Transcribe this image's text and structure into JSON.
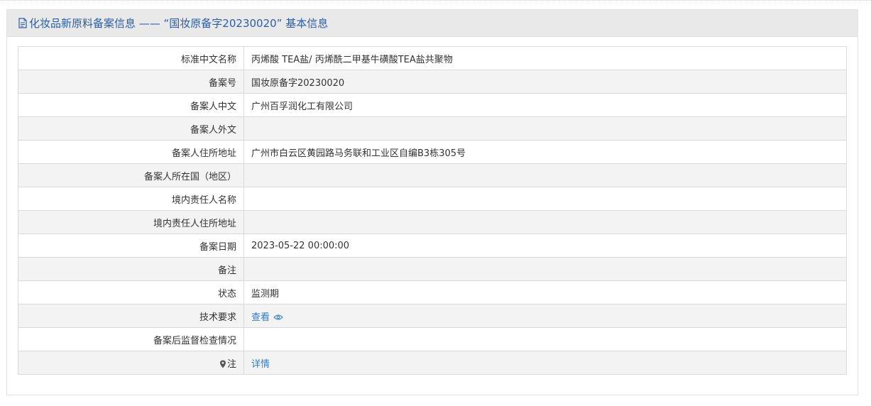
{
  "header": {
    "title": "化妆品新原料备案信息 —— “国妆原备字20230020” 基本信息"
  },
  "rows": [
    {
      "label": "标准中文名称",
      "value": "丙烯酸 TEA盐/ 丙烯酰二甲基牛磺酸TEA盐共聚物"
    },
    {
      "label": "备案号",
      "value": "国妆原备字20230020"
    },
    {
      "label": "备案人中文",
      "value": "广州百孚润化工有限公司"
    },
    {
      "label": "备案人外文",
      "value": ""
    },
    {
      "label": "备案人住所地址",
      "value": "广州市白云区黄园路马务联和工业区自编B3栋305号"
    },
    {
      "label": "备案人所在国（地区）",
      "value": ""
    },
    {
      "label": "境内责任人名称",
      "value": ""
    },
    {
      "label": "境内责任人住所地址",
      "value": ""
    },
    {
      "label": "备案日期",
      "value": "2023-05-22 00:00:00"
    },
    {
      "label": "备注",
      "value": ""
    },
    {
      "label": "状态",
      "value": "监测期"
    },
    {
      "label": "技术要求",
      "value": "查看"
    },
    {
      "label": "备案后监督检查情况",
      "value": ""
    },
    {
      "label": "注",
      "value": "详情"
    }
  ],
  "icons": {
    "header_icon": "document-icon",
    "view_icon": "eye-icon",
    "note_icon": "pin-icon"
  },
  "colors": {
    "title": "#2b5ea6",
    "link": "#2f7cc6",
    "header_bg": "#e9e9e9",
    "stripe": "#f3f3f3"
  }
}
